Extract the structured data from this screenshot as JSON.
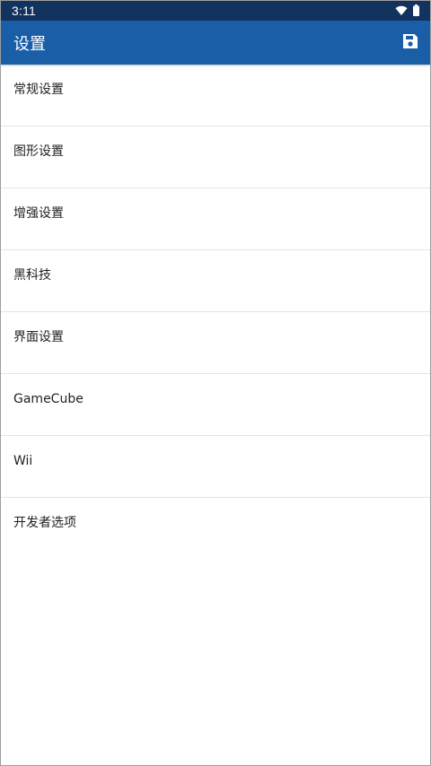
{
  "status_bar": {
    "time": "3:11",
    "icons": [
      "wifi-icon",
      "battery-icon"
    ]
  },
  "app_bar": {
    "title": "设置",
    "action_icon": "save-icon"
  },
  "settings": {
    "items": [
      {
        "label": "常规设置"
      },
      {
        "label": "图形设置"
      },
      {
        "label": "增强设置"
      },
      {
        "label": "黑科技"
      },
      {
        "label": "界面设置"
      },
      {
        "label": "GameCube"
      },
      {
        "label": "Wii"
      },
      {
        "label": "开发者选项"
      }
    ]
  },
  "colors": {
    "status_bar": "#13335f",
    "app_bar": "#1a5ea7",
    "divider": "#e4e4e4",
    "text": "#222222"
  }
}
